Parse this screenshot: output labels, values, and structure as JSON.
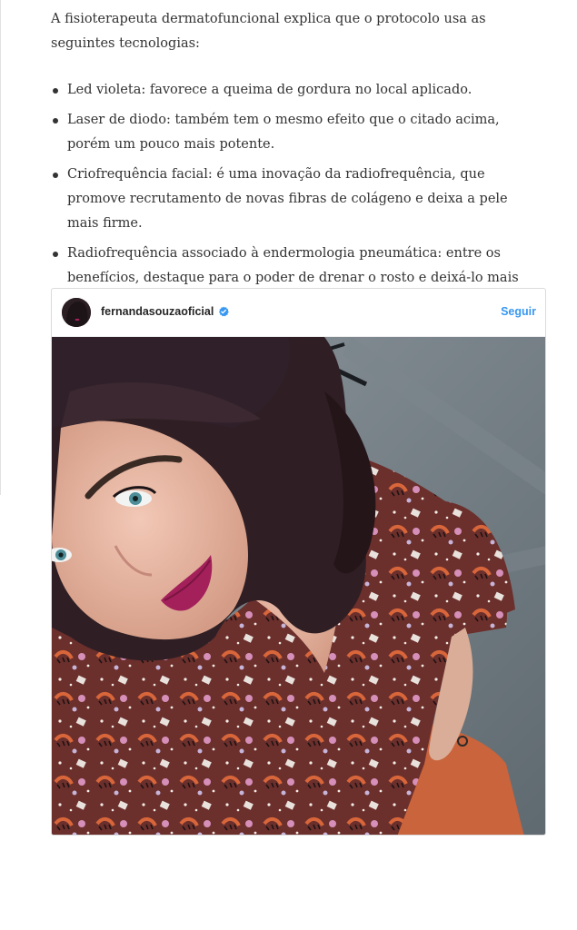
{
  "article": {
    "intro": "A fisioterapeuta dermatofuncional explica que o protocolo usa as seguintes tecnologias:",
    "bullets": [
      "Led violeta: favorece a queima de gordura no local aplicado.",
      "Laser de diodo: também tem o mesmo efeito que o citado acima, porém um pouco mais potente.",
      "Criofrequência facial: é uma inovação da radiofrequência, que promove recrutamento de novas fibras de colágeno e deixa a pele mais firme.",
      "Radiofrequência associado à endermologia pneumática: entre os benefícios, destaque para o poder de drenar o rosto e deixá-lo mais fino."
    ]
  },
  "instagram_embed": {
    "username": "fernandasouzaoficial",
    "follow_label": "Seguir",
    "verified": true,
    "accent_color": "#3897f0",
    "avatar_icon": "profile-avatar",
    "verified_icon": "verified-badge-icon"
  }
}
